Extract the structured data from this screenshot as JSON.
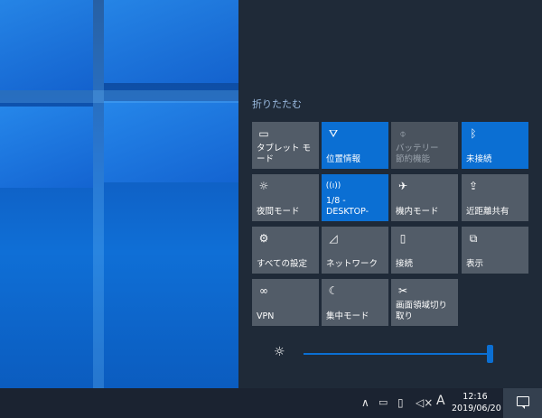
{
  "action_center": {
    "collapse_label": "折りたたむ",
    "tiles": [
      {
        "label": "タブレット モード",
        "icon": "tablet-mode-icon",
        "glyph": "▭"
      },
      {
        "label": "位置情報",
        "icon": "location-icon",
        "glyph": "⛛"
      },
      {
        "label": "バッテリー\n節約機能",
        "icon": "battery-saver-icon",
        "glyph": "⌽"
      },
      {
        "label": "未接続",
        "icon": "bluetooth-icon",
        "glyph": "ᛒ"
      },
      {
        "label": "夜間モード",
        "icon": "night-light-icon",
        "glyph": "☼"
      },
      {
        "label": "1/8 -\nDESKTOP-",
        "icon": "mobile-hotspot-icon",
        "glyph": "((ı))"
      },
      {
        "label": "機内モード",
        "icon": "airplane-mode-icon",
        "glyph": "✈"
      },
      {
        "label": "近距離共有",
        "icon": "nearby-sharing-icon",
        "glyph": "⇪"
      },
      {
        "label": "すべての設定",
        "icon": "settings-gear-icon",
        "glyph": "⚙"
      },
      {
        "label": "ネットワーク",
        "icon": "network-icon",
        "glyph": "◿"
      },
      {
        "label": "接続",
        "icon": "connect-icon",
        "glyph": "▯"
      },
      {
        "label": "表示",
        "icon": "project-icon",
        "glyph": "⧉"
      },
      {
        "label": "VPN",
        "icon": "vpn-icon",
        "glyph": "∞"
      },
      {
        "label": "集中モード",
        "icon": "focus-assist-icon",
        "glyph": "☾"
      },
      {
        "label": "画面領域切り取り",
        "icon": "screen-snip-icon",
        "glyph": "✂"
      }
    ],
    "brightness": {
      "level": 1.0,
      "icon": "brightness-icon"
    }
  },
  "taskbar": {
    "tray_icons": [
      "show-hidden-icons-chevron-icon",
      "battery-icon",
      "network-status-icon",
      "volume-muted-icon",
      "ime-mode-icon"
    ],
    "ime_mode": "A",
    "clock_time": "12:16",
    "clock_date": "2019/06/20",
    "notification_icon": "notifications-icon"
  },
  "colors": {
    "accent": "#0b6fd3",
    "tile_off": "#525c68",
    "panel_bg": "#1f2a38",
    "taskbar_bg": "#1b2331"
  }
}
